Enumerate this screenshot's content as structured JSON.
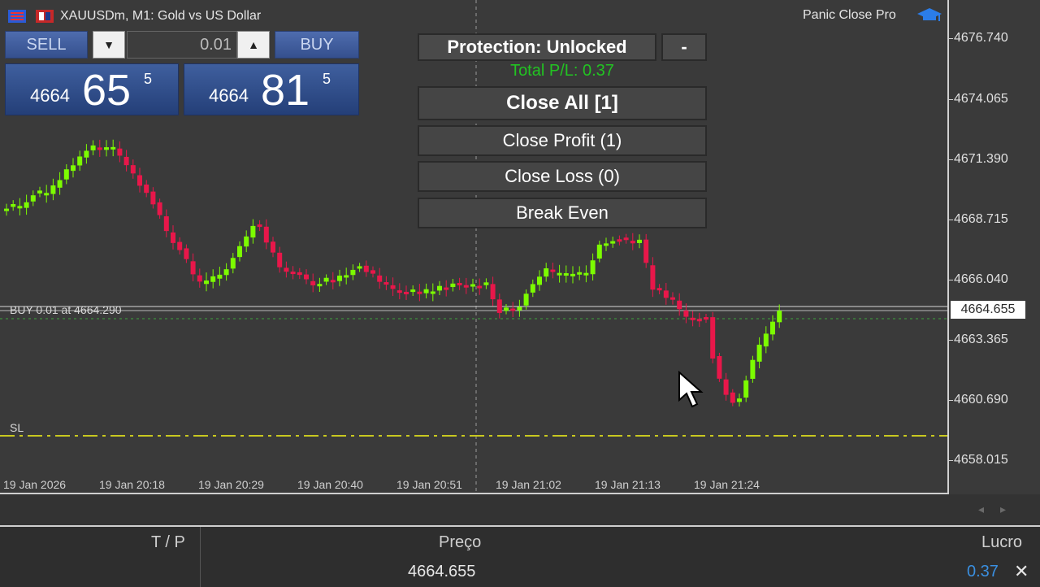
{
  "chart": {
    "title": "XAUUSDm, M1:  Gold vs US Dollar",
    "ea_name": "Panic Close Pro"
  },
  "trade_panel": {
    "sell_label": "SELL",
    "buy_label": "BUY",
    "volume": "0.01",
    "sell_price": {
      "prefix": "4664",
      "big": "65",
      "sup": "5"
    },
    "buy_price": {
      "prefix": "4664",
      "big": "81",
      "sup": "5"
    }
  },
  "panic_panel": {
    "protection": "Protection: Unlocked",
    "minimize": "-",
    "total_pl": "Total P/L: 0.37",
    "close_all": "Close All [1]",
    "close_profit": "Close Profit (1)",
    "close_loss": "Close Loss (0)",
    "break_even": "Break Even"
  },
  "price_axis": {
    "ticks": [
      "4676.740",
      "4674.065",
      "4671.390",
      "4668.715",
      "4666.040",
      "4663.365",
      "4660.690",
      "4658.015"
    ],
    "current_price": "4664.655"
  },
  "time_axis": {
    "labels": [
      "19 Jan 2026",
      "19 Jan 20:18",
      "19 Jan 20:29",
      "19 Jan 20:40",
      "19 Jan 20:51",
      "19 Jan 21:02",
      "19 Jan 21:13",
      "19 Jan 21:24"
    ]
  },
  "levels": {
    "buy_line_label": "BUY 0.01 at 4664.290",
    "sl_label": "SL"
  },
  "colors": {
    "bull": "#7cfc00",
    "bear": "#e8174a",
    "profit_text": "#22c322"
  },
  "positions_table": {
    "headers": {
      "tp": "T / P",
      "price": "Preço",
      "profit": "Lucro"
    },
    "row": {
      "price": "4664.655",
      "profit": "0.37"
    },
    "close_icon": "close-icon"
  }
}
